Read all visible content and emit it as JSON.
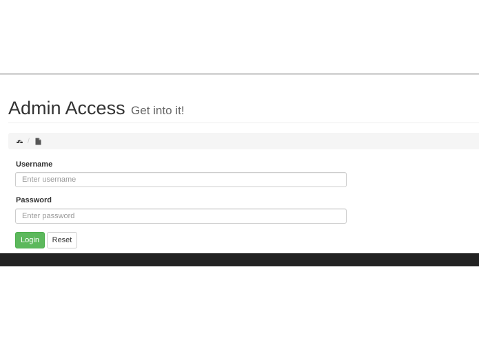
{
  "header": {
    "title": "Admin Access",
    "subtitle": "Get into it!"
  },
  "breadcrumb": {
    "items": [
      {
        "icon": "dashboard-icon"
      },
      {
        "icon": "file-icon"
      }
    ],
    "separator": "/"
  },
  "form": {
    "username": {
      "label": "Username",
      "placeholder": "Enter username",
      "value": ""
    },
    "password": {
      "label": "Password",
      "placeholder": "Enter password",
      "value": ""
    },
    "login_label": "Login",
    "reset_label": "Reset"
  },
  "colors": {
    "login_button": "#5cb85c",
    "footer": "#222222",
    "breadcrumb_bg": "#f5f5f5"
  }
}
